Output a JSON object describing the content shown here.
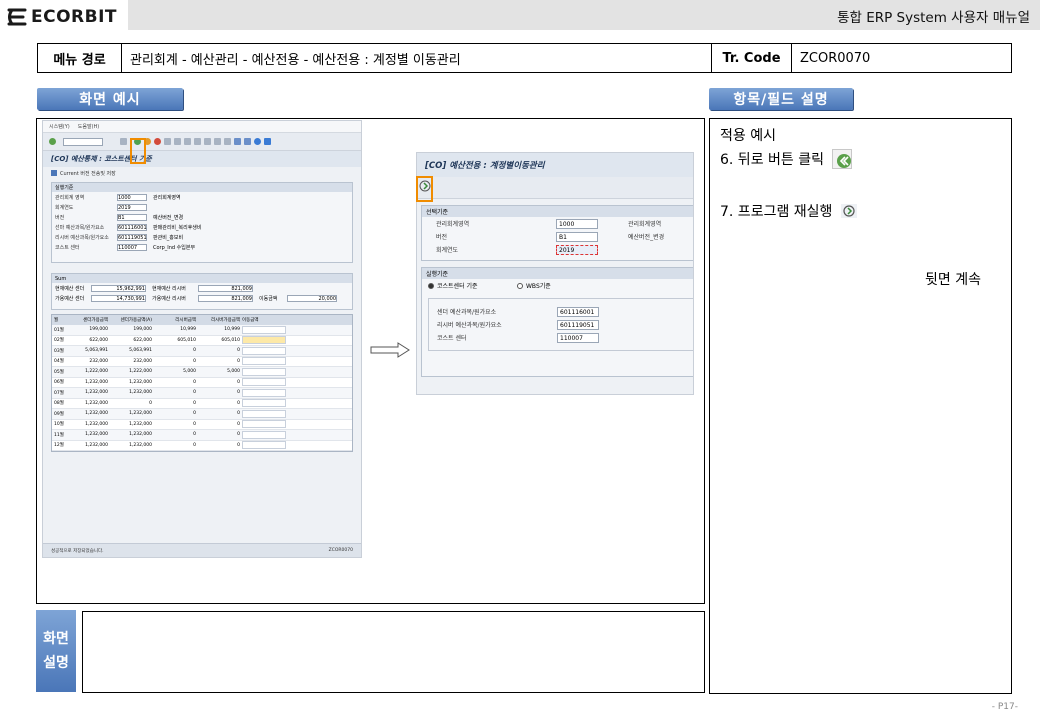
{
  "header": {
    "logo_text": "ECORBIT",
    "manual_title": "통합 ERP System 사용자 매뉴얼"
  },
  "pathbar": {
    "menu_label": "메뉴 경로",
    "menu_path": "관리회계 - 예산관리 - 예산전용 - 예산전용 : 계정별 이동관리",
    "tr_label": "Tr. Code",
    "tr_code": "ZCOR0070"
  },
  "sections": {
    "screen_example": "화면 예시",
    "field_desc": "항목/필드 설명",
    "screen_desc_line1": "화면",
    "screen_desc_line2": "설명"
  },
  "right_panel": {
    "line1": "적용 예시",
    "line2": "6. 뒤로 버튼 클릭",
    "line3": "7. 프로그램 재실행",
    "continued": "뒷면 계속"
  },
  "screenshot1": {
    "title": "[CO] 예산통제 : 코스트센터 기준",
    "menu_items": [
      "시스템(Y)",
      "도움말(H)"
    ],
    "subtoolbar": "Current 버전 전송및 저장",
    "group_head": "실행기준",
    "fields": [
      {
        "label": "관리회계 영역",
        "value": "1000",
        "extra": "관리회계영역"
      },
      {
        "label": "회계연도",
        "value": "2019",
        "extra": ""
      },
      {
        "label": "버전",
        "value": "B1",
        "extra": "예산버전_변경"
      },
      {
        "label": "선마 예산과목/원가요소",
        "value": "601116001",
        "extra": "판매관리비_복리후생비"
      },
      {
        "label": "리시버 예산과목/원가요소",
        "value": "601119051",
        "extra": "판관비_홍보비"
      },
      {
        "label": "코스트 센터",
        "value": "110007",
        "extra": "Corp_Ind 수입본부"
      }
    ],
    "sum_head": "Sum",
    "sum_rows": [
      {
        "l1": "현재예산 센더",
        "v1": "15,962,991",
        "l2": "현재예산 리시버",
        "v2": "821,009"
      },
      {
        "l1": "가용예산 센더",
        "v1": "14,730,991",
        "l2": "가용예산 리시버",
        "v2": "821,009",
        "l3": "이동금액",
        "v3": "20,000"
      }
    ],
    "grid_headers": [
      "월",
      "센더가용금액",
      "센더가용금액(A)",
      "리시버금액",
      "리시버가용금액",
      "이동금액"
    ],
    "grid_rows": [
      [
        "01월",
        "199,000",
        "199,000",
        "10,999",
        "10,999"
      ],
      [
        "02월",
        "622,000",
        "622,000",
        "605,010",
        "605,010"
      ],
      [
        "03월",
        "5,063,991",
        "5,063,991",
        "0",
        "0"
      ],
      [
        "04월",
        "232,000",
        "232,000",
        "0",
        "0"
      ],
      [
        "05월",
        "1,222,000",
        "1,222,000",
        "5,000",
        "5,000"
      ],
      [
        "06월",
        "1,232,000",
        "1,232,000",
        "0",
        "0"
      ],
      [
        "07월",
        "1,232,000",
        "1,232,000",
        "0",
        "0"
      ],
      [
        "08월",
        "1,232,000",
        "0",
        "0",
        "0"
      ],
      [
        "09월",
        "1,232,000",
        "1,232,000",
        "0",
        "0"
      ],
      [
        "10월",
        "1,232,000",
        "1,232,000",
        "0",
        "0"
      ],
      [
        "11월",
        "1,232,000",
        "1,232,000",
        "0",
        "0"
      ],
      [
        "12월",
        "1,232,000",
        "1,232,000",
        "0",
        "0"
      ]
    ],
    "status_left": "성공적으로 저장되었습니다.",
    "status_right": "ZCOR0070"
  },
  "screenshot2": {
    "title": "[CO] 예산전용 : 계정별이동관리",
    "group1_head": "선택기준",
    "group1_rows": [
      {
        "label": "관리회계영역",
        "value": "1000",
        "extra": "관리회계영역"
      },
      {
        "label": "버전",
        "value": "B1",
        "extra": "예산버전_변경"
      },
      {
        "label": "회계연도",
        "value": "2019",
        "extra": ""
      }
    ],
    "group2_head": "실행기준",
    "radio1": "코스트센터 기준",
    "radio2": "WBS기준",
    "group2_rows": [
      {
        "label": "센더 예산과목/원가요소",
        "value": "601116001"
      },
      {
        "label": "리시버 예산과목/원가요소",
        "value": "601119051"
      },
      {
        "label": "코스트 센터",
        "value": "110007"
      }
    ]
  },
  "page_number": "- P17-",
  "colors": {
    "accent_blue": "#4a76b8",
    "highlight_orange": "#f08c00",
    "header_gray": "#e3e3e3"
  }
}
